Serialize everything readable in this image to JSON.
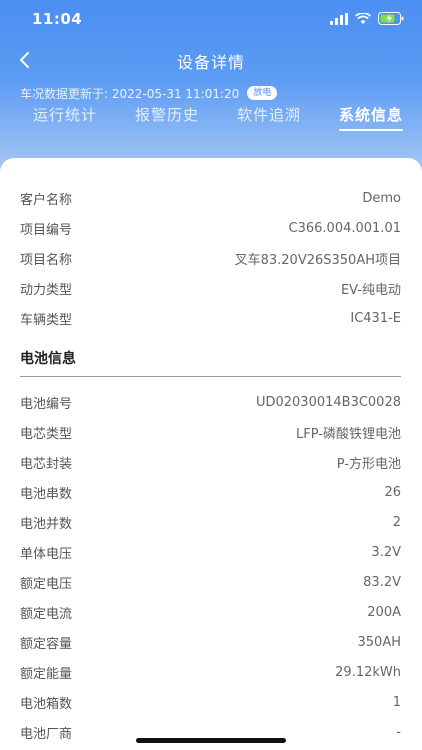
{
  "status_bar": {
    "time": "11:04"
  },
  "nav": {
    "title": "设备详情"
  },
  "update": {
    "text": "车况数据更新于: 2022-05-31 11:01:20",
    "badge": "放电"
  },
  "tabs": [
    {
      "label": "运行统计"
    },
    {
      "label": "报警历史"
    },
    {
      "label": "软件追溯"
    },
    {
      "label": "系统信息"
    }
  ],
  "vehicle_info": [
    {
      "label": "客户名称",
      "value": "Demo"
    },
    {
      "label": "项目编号",
      "value": "C366.004.001.01"
    },
    {
      "label": "项目名称",
      "value": "叉车83.20V26S350AH项目"
    },
    {
      "label": "动力类型",
      "value": "EV-纯电动"
    },
    {
      "label": "车辆类型",
      "value": "IC431-E"
    }
  ],
  "battery_section": {
    "title": "电池信息"
  },
  "battery_info": [
    {
      "label": "电池编号",
      "value": "UD02030014B3C0028"
    },
    {
      "label": "电芯类型",
      "value": "LFP-磷酸铁锂电池"
    },
    {
      "label": "电芯封装",
      "value": "P-方形电池"
    },
    {
      "label": "电池串数",
      "value": "26"
    },
    {
      "label": "电池并数",
      "value": "2"
    },
    {
      "label": "单体电压",
      "value": "3.2V"
    },
    {
      "label": "额定电压",
      "value": "83.2V"
    },
    {
      "label": "额定电流",
      "value": "200A"
    },
    {
      "label": "额定容量",
      "value": "350AH"
    },
    {
      "label": "额定能量",
      "value": "29.12kWh"
    },
    {
      "label": "电池箱数",
      "value": "1"
    },
    {
      "label": "电池厂商",
      "value": "-"
    }
  ]
}
